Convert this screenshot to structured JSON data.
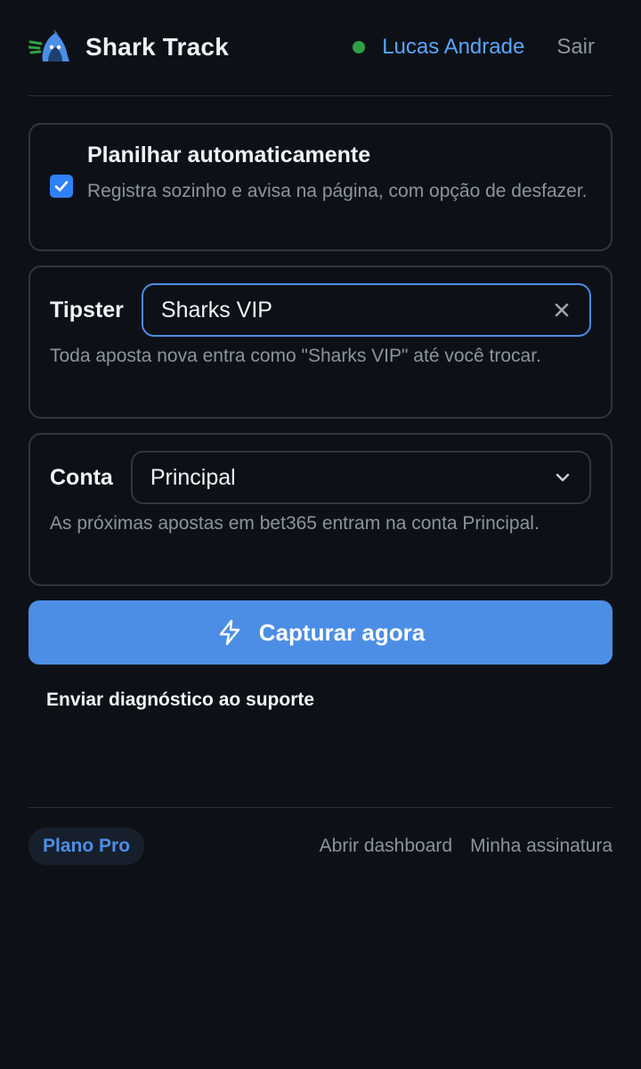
{
  "header": {
    "brand": "Shark Track",
    "user_name": "Lucas Andrade",
    "logout_label": "Sair"
  },
  "auto_sheet": {
    "checked": true,
    "title": "Planilhar automaticamente",
    "description": "Registra sozinho e avisa na página, com opção de desfazer."
  },
  "tipster": {
    "label": "Tipster",
    "value": "Sharks VIP",
    "help": "Toda aposta nova entra como \"Sharks VIP\" até você trocar."
  },
  "account": {
    "label": "Conta",
    "selected": "Principal",
    "help": "As próximas apostas em bet365 entram na conta Principal."
  },
  "capture_button": {
    "label": "Capturar agora"
  },
  "diagnostic_link": "Enviar diagnóstico ao suporte",
  "footer": {
    "plan_badge": "Plano Pro",
    "dashboard_link": "Abrir dashboard",
    "subscription_link": "Minha assinatura"
  },
  "colors": {
    "background": "#0d1117",
    "accent": "#4c8ee6",
    "status_online": "#2ea043",
    "user_link": "#58a6ff"
  },
  "icons": {
    "logo": "shark-logo-icon",
    "checkbox": "check-icon",
    "clear": "close-icon",
    "dropdown": "chevron-down-icon",
    "capture": "lightning-bolt-icon"
  }
}
